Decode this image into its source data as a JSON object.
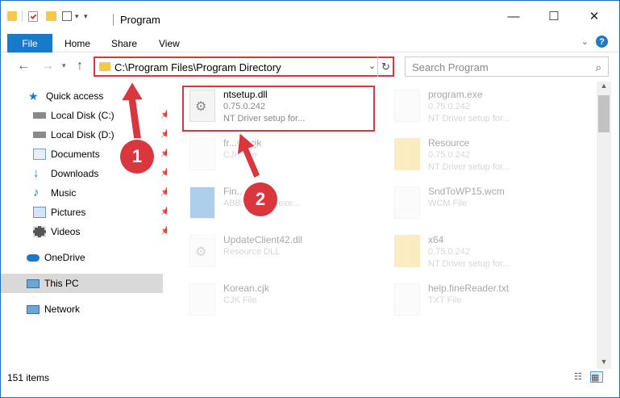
{
  "window": {
    "title": "Program",
    "minimize": "—",
    "maximize": "☐",
    "close": "✕"
  },
  "ribbon": {
    "file_tab": "File",
    "tabs": [
      "Home",
      "Share",
      "View"
    ],
    "help": "?"
  },
  "nav": {
    "address": "C:\\Program Files\\Program Directory",
    "search_placeholder": "Search Program"
  },
  "sidebar": {
    "items": [
      {
        "label": "Quick access",
        "icon": "star-icon",
        "pinned": false
      },
      {
        "label": "Local Disk (C:)",
        "icon": "drive-icon",
        "pinned": true
      },
      {
        "label": "Local Disk (D:)",
        "icon": "drive-icon",
        "pinned": true
      },
      {
        "label": "Documents",
        "icon": "documents-icon",
        "pinned": true
      },
      {
        "label": "Downloads",
        "icon": "downloads-icon",
        "pinned": true
      },
      {
        "label": "Music",
        "icon": "music-icon",
        "pinned": true
      },
      {
        "label": "Pictures",
        "icon": "pictures-icon",
        "pinned": true
      },
      {
        "label": "Videos",
        "icon": "videos-icon",
        "pinned": true
      },
      {
        "label": "OneDrive",
        "icon": "cloud-icon",
        "pinned": false
      },
      {
        "label": "This PC",
        "icon": "computer-icon",
        "pinned": false,
        "selected": true
      },
      {
        "label": "Network",
        "icon": "network-icon",
        "pinned": false
      }
    ]
  },
  "files": [
    {
      "name": "ntsetup.dll",
      "sub1": "0.75.0.242",
      "sub2": "NT Driver setup for...",
      "kind": "dll",
      "highlighted": true
    },
    {
      "name": "program.exe",
      "sub1": "0.75.0.242",
      "sub2": "NT Driver setup for...",
      "kind": "exe",
      "highlighted": false
    },
    {
      "name": "fr...ml.cjk",
      "sub1": "CJK File",
      "sub2": "",
      "kind": "file",
      "highlighted": false
    },
    {
      "name": "Resource",
      "sub1": "0.75.0.242",
      "sub2": "NT Driver setup for...",
      "kind": "folder",
      "highlighted": false
    },
    {
      "name": "Fin...exe",
      "sub1": "ABB...ground exe...",
      "sub2": "",
      "kind": "app",
      "highlighted": false
    },
    {
      "name": "SndToWP15.wcm",
      "sub1": "WCM File",
      "sub2": "",
      "kind": "file",
      "highlighted": false
    },
    {
      "name": "UpdateClient42.dll",
      "sub1": "Resource DLL",
      "sub2": "",
      "kind": "dll",
      "highlighted": false
    },
    {
      "name": "x64",
      "sub1": "0.75.0.242",
      "sub2": "NT Driver setup for...",
      "kind": "folder",
      "highlighted": false
    },
    {
      "name": "Korean.cjk",
      "sub1": "CJK File",
      "sub2": "",
      "kind": "file",
      "highlighted": false
    },
    {
      "name": "help.fineReader.txt",
      "sub1": "TXT File",
      "sub2": "",
      "kind": "file",
      "highlighted": false
    }
  ],
  "status": {
    "item_count": "151 items"
  },
  "annotations": {
    "step1": "1",
    "step2": "2",
    "color": "#d9363e"
  }
}
